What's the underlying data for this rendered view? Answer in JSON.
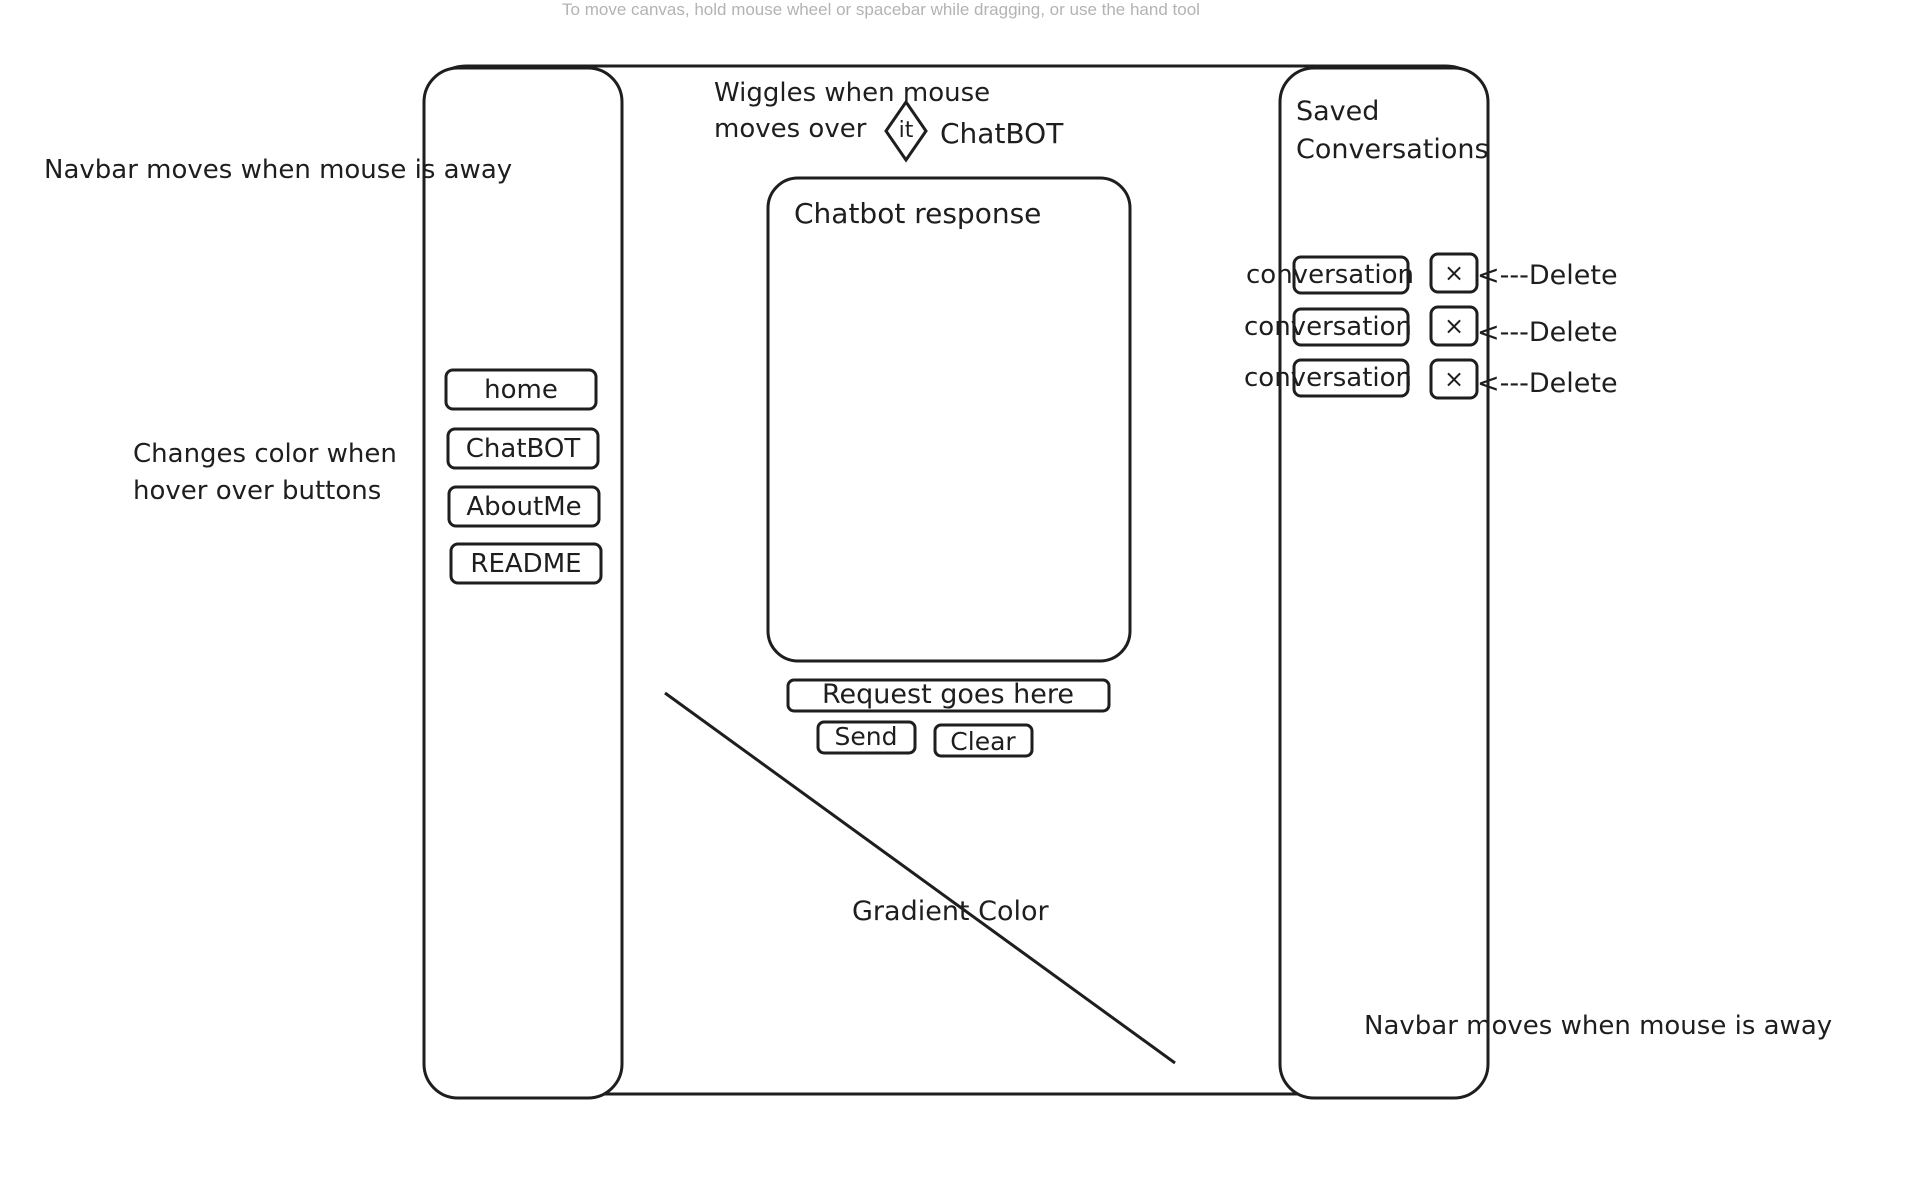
{
  "canvas_hint": "To move canvas, hold mouse wheel or spacebar while dragging, or use the hand tool",
  "annotations": {
    "navbar_left_note": "Navbar moves when mouse is away",
    "hover_note_line1": "Changes color when",
    "hover_note_line2": "hover over buttons",
    "wiggle_note_line1": "Wiggles when mouse",
    "wiggle_note_line2": "moves over",
    "wiggle_icon_text": "it",
    "gradient_note": "Gradient Color",
    "navbar_right_note": "Navbar moves when mouse is away"
  },
  "header": {
    "title": "ChatBOT"
  },
  "left_nav": {
    "items": [
      {
        "label": "home"
      },
      {
        "label": "ChatBOT"
      },
      {
        "label": "AboutMe"
      },
      {
        "label": "README"
      }
    ]
  },
  "chat": {
    "response_title": "Chatbot response",
    "request_placeholder": "Request goes here",
    "send_label": "Send",
    "clear_label": "Clear"
  },
  "right_panel": {
    "title_line1": "Saved",
    "title_line2": "Conversations",
    "conversations": [
      {
        "label": "conversation",
        "delete_icon": "×",
        "delete_note": "<---Delete"
      },
      {
        "label": "conversation",
        "delete_icon": "×",
        "delete_note": "<---Delete"
      },
      {
        "label": "conversation",
        "delete_icon": "×",
        "delete_note": "<---Delete"
      }
    ]
  }
}
